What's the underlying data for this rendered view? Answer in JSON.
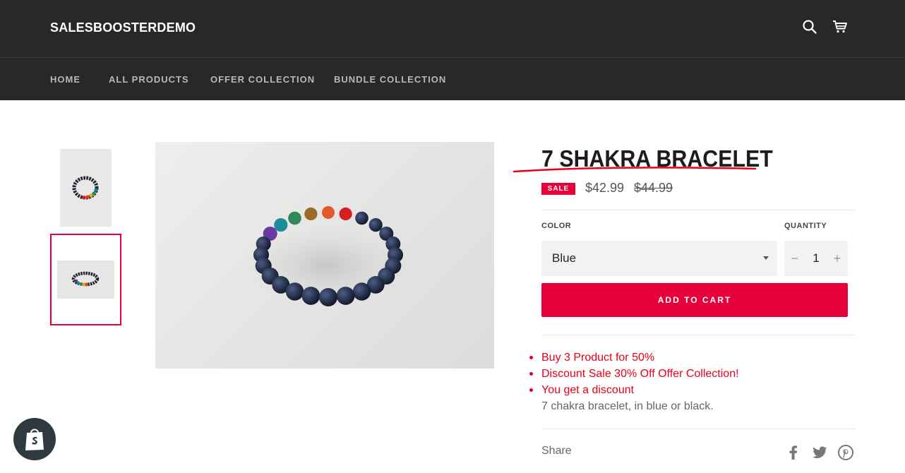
{
  "header": {
    "logo": "SALESBOOSTERDEMO",
    "icons": [
      "search-icon",
      "cart-icon"
    ]
  },
  "nav": {
    "items": [
      {
        "label": "HOME"
      },
      {
        "label": "ALL PRODUCTS"
      },
      {
        "label": "OFFER COLLECTION"
      },
      {
        "label": "BUNDLE COLLECTION"
      }
    ]
  },
  "product": {
    "title": "7 SHAKRA BRACELET",
    "sale_badge": "SALE",
    "price": "$42.99",
    "compare_price": "$44.99",
    "color_label": "COLOR",
    "color_value": "Blue",
    "quantity_label": "QUANTITY",
    "quantity_value": "1",
    "qty_minus": "−",
    "qty_plus": "+",
    "add_to_cart": "ADD TO CART",
    "offers": [
      "Buy 3 Product for 50%",
      "Discount Sale 30% Off Offer Collection!",
      "You get a discount"
    ],
    "description": "7 chakra bracelet, in blue or black.",
    "share_label": "Share",
    "selected_thumbnail": 2
  },
  "colors": {
    "header_bg": "#282828",
    "accent": "#e8003a",
    "offer_text": "#e8001c"
  }
}
